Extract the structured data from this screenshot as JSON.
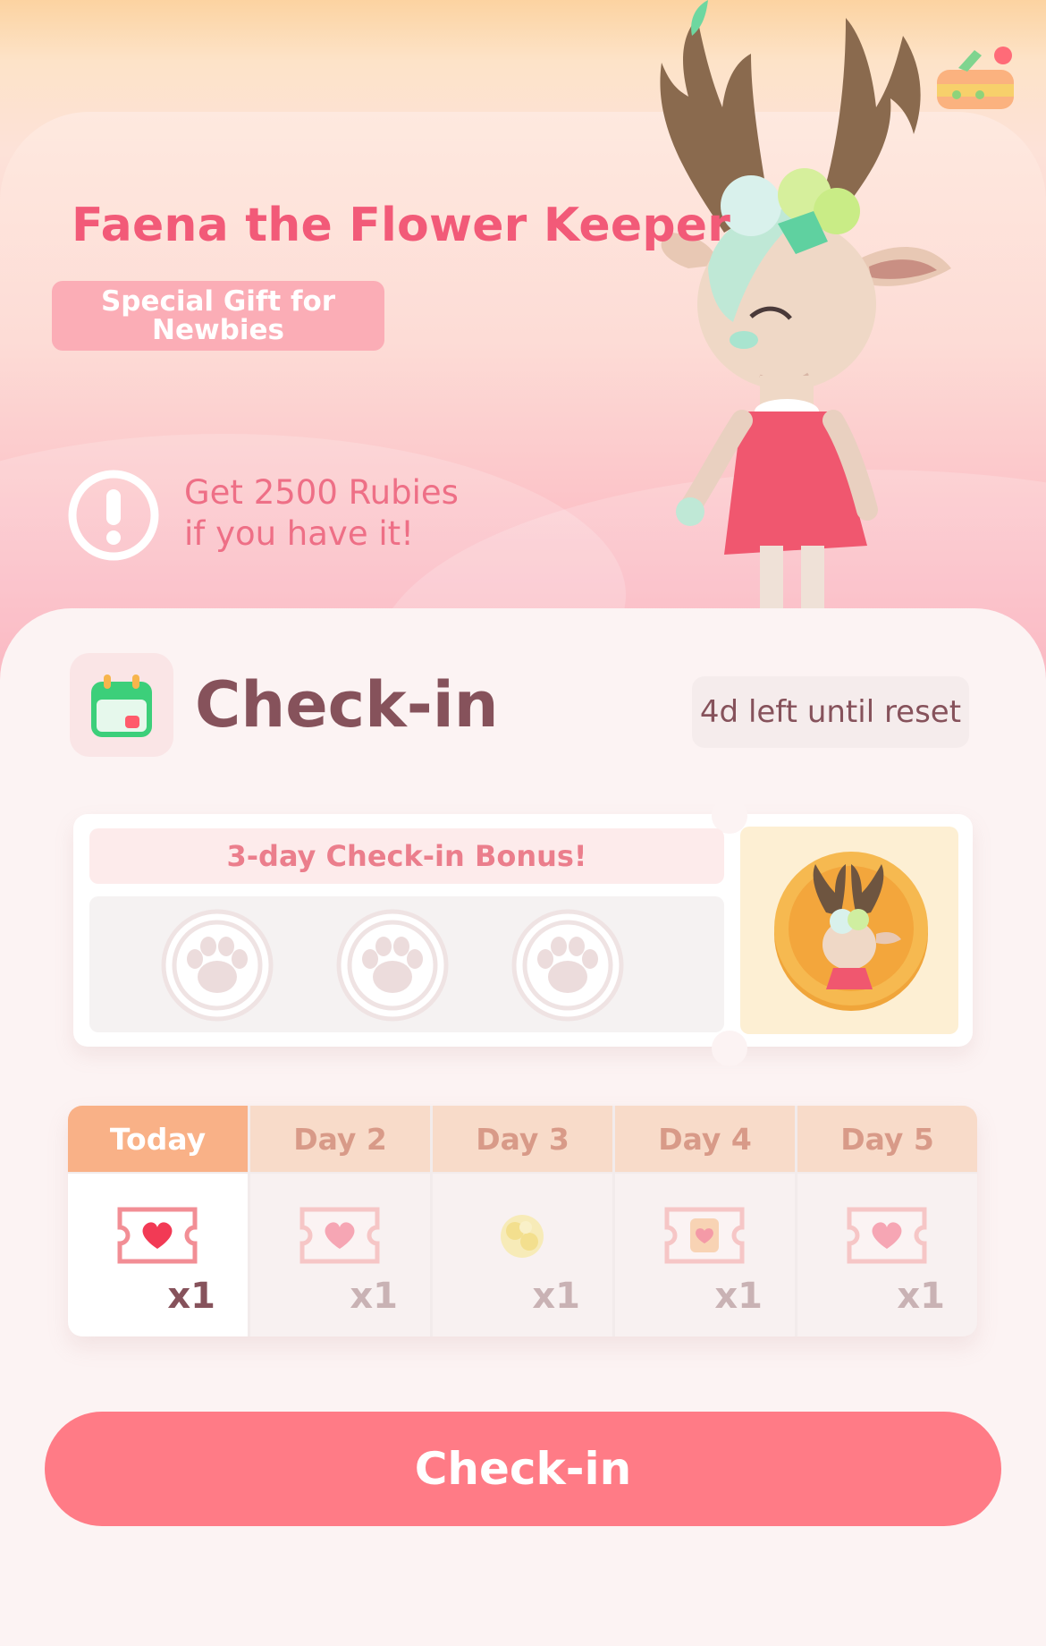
{
  "hero": {
    "title": "Faena the Flower Keeper",
    "badge": "Special Gift for Newbies",
    "alert_line1": "Get 2500 Rubies",
    "alert_line2": "if you have it!"
  },
  "checkin": {
    "title": "Check-in",
    "reset_text": "4d left until reset",
    "bonus_title": "3-day Check-in Bonus!",
    "days": [
      {
        "label": "Today",
        "reward": "heart-ticket-icon",
        "qty": "x1"
      },
      {
        "label": "Day 2",
        "reward": "heart-ticket-icon",
        "qty": "x1"
      },
      {
        "label": "Day 3",
        "reward": "yarn-ball-icon",
        "qty": "x1"
      },
      {
        "label": "Day 4",
        "reward": "sticker-ticket-icon",
        "qty": "x1"
      },
      {
        "label": "Day 5",
        "reward": "heart-ticket-icon",
        "qty": "x1"
      }
    ],
    "button_label": "Check-in"
  },
  "colors": {
    "accent": "#ff7b86",
    "title_pink": "#f25a78",
    "brown_text": "#86525b",
    "today_header": "#f9b187",
    "calendar_green": "#3ccf7a"
  }
}
